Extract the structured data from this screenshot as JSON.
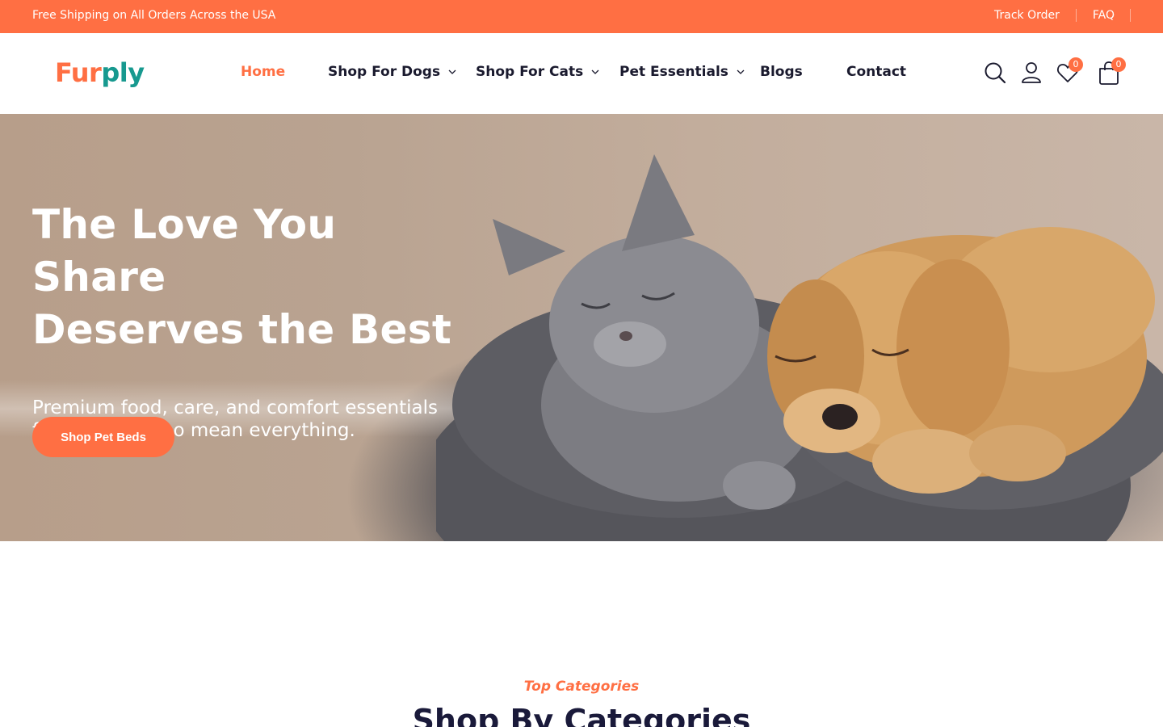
{
  "topbar": {
    "promo": "Free Shipping on All Orders Across the USA",
    "links": [
      "Track Order",
      "FAQ"
    ]
  },
  "brand": {
    "logo_part1": "Fur",
    "logo_part2": "ply",
    "colors": {
      "accent": "#ff6f43",
      "teal": "#17998f"
    }
  },
  "nav": {
    "items": [
      {
        "label": "Home",
        "active": true,
        "dropdown": false
      },
      {
        "label": "Shop For Dogs",
        "active": false,
        "dropdown": true
      },
      {
        "label": "Shop For Cats",
        "active": false,
        "dropdown": true
      },
      {
        "label": "Pet Essentials",
        "active": false,
        "dropdown": true
      },
      {
        "label": "Blogs",
        "active": false,
        "dropdown": false
      },
      {
        "label": "Contact",
        "active": false,
        "dropdown": false
      }
    ]
  },
  "header_icons": {
    "search": "search-icon",
    "account": "user-icon",
    "wishlist": "heart-icon",
    "cart": "bag-icon",
    "wishlist_count": "0",
    "cart_count": "0"
  },
  "hero": {
    "title_line1": "The Love You Share",
    "title_line2": "Deserves the Best",
    "subtitle_line1": "Premium food, care, and comfort essentials",
    "subtitle_line2": "for the pets who mean everything.",
    "cta": "Shop Pet Beds"
  },
  "categories": {
    "eyebrow": "Top Categories",
    "title": "Shop By Categories"
  }
}
